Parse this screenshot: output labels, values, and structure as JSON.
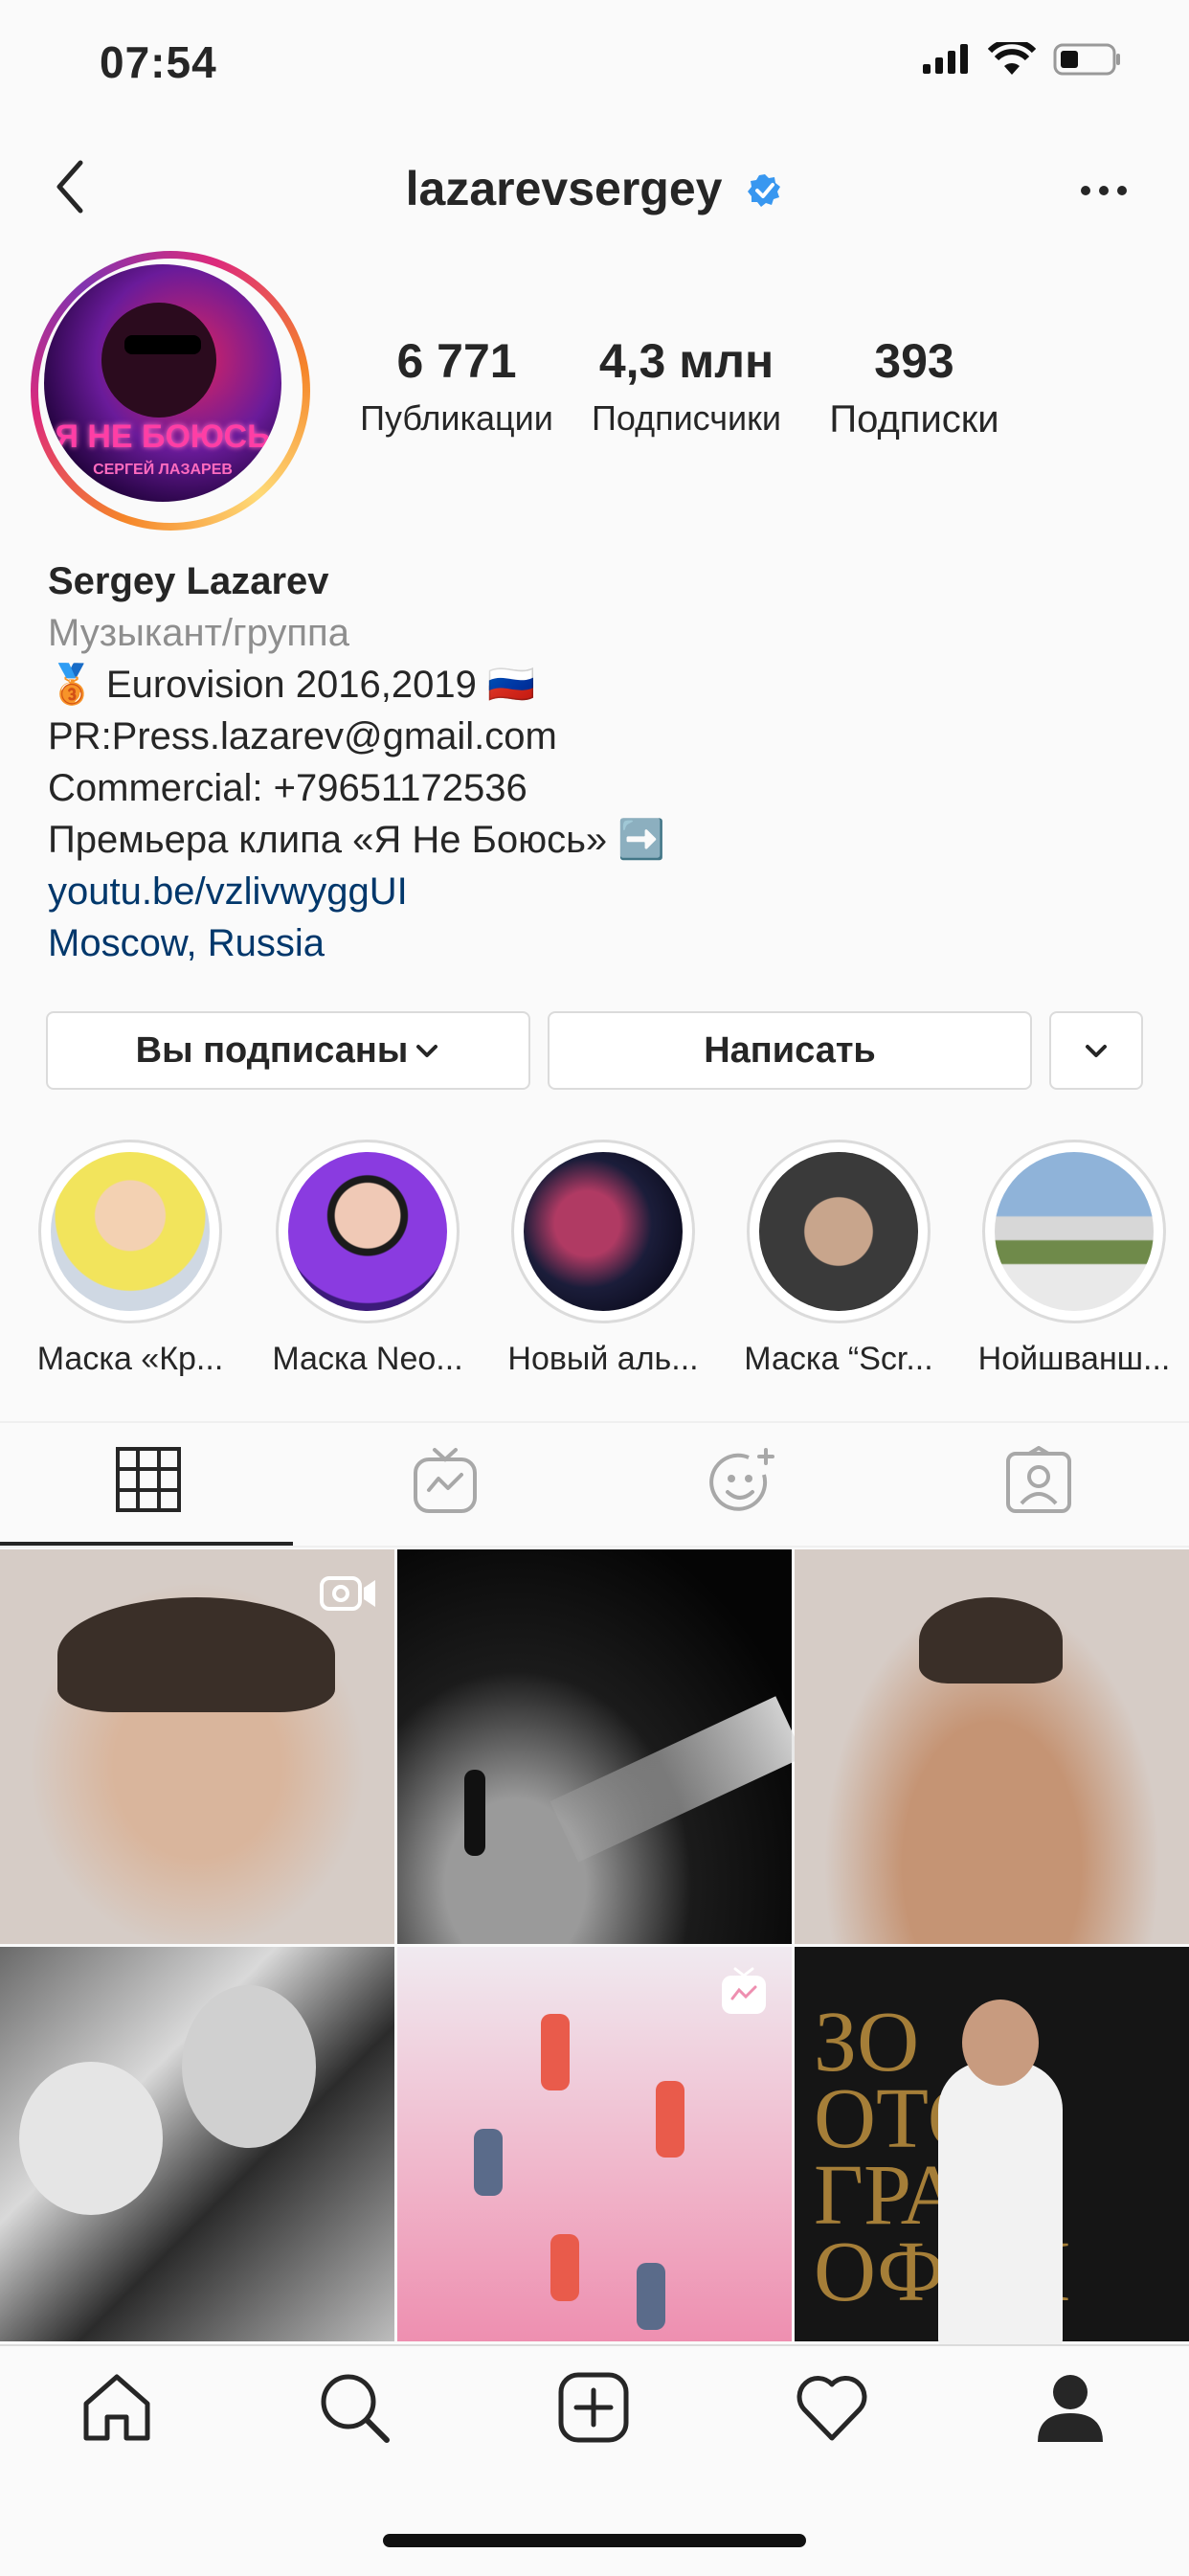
{
  "status_bar": {
    "time": "07:54"
  },
  "header": {
    "username": "lazarevsergey"
  },
  "avatar": {
    "title_text": "Я НЕ БОЮСЬ",
    "subtitle_text": "СЕРГЕЙ ЛАЗАРЕВ"
  },
  "stats": {
    "posts": {
      "value": "6 771",
      "label": "Публикации"
    },
    "followers": {
      "value": "4,3 млн",
      "label": "Подписчики"
    },
    "following": {
      "value": "393",
      "label": "Подписки"
    }
  },
  "bio": {
    "name": "Sergey Lazarev",
    "category": "Музыкант/группа",
    "line1": "🥉 Eurovision 2016,2019 🇷🇺",
    "line2": "PR:Press.lazarev@gmail.com",
    "line3": "Commercial: +79651172536",
    "line4": "Премьера клипа «Я Не Боюсь» ➡️",
    "link": "youtu.be/vzlivwyggUI",
    "location": "Moscow, Russia"
  },
  "actions": {
    "following_label": "Вы подписаны",
    "message_label": "Написать"
  },
  "highlights": [
    {
      "caption": "Маска «Кр...",
      "color": "#f2e45c"
    },
    {
      "caption": "Маска Neo...",
      "color": "#8a3be0"
    },
    {
      "caption": "Новый аль...",
      "color": "#1b1d3a"
    },
    {
      "caption": "Маска “Scr...",
      "color": "#3a3a3a"
    },
    {
      "caption": "Нойшванш...",
      "color": "#8fb3d9"
    }
  ],
  "tabs": [
    "grid-icon",
    "igtv-icon",
    "effects-icon",
    "tagged-icon"
  ],
  "bottom_nav": [
    "home-icon",
    "search-icon",
    "new-post-icon",
    "activity-icon",
    "profile-icon"
  ]
}
